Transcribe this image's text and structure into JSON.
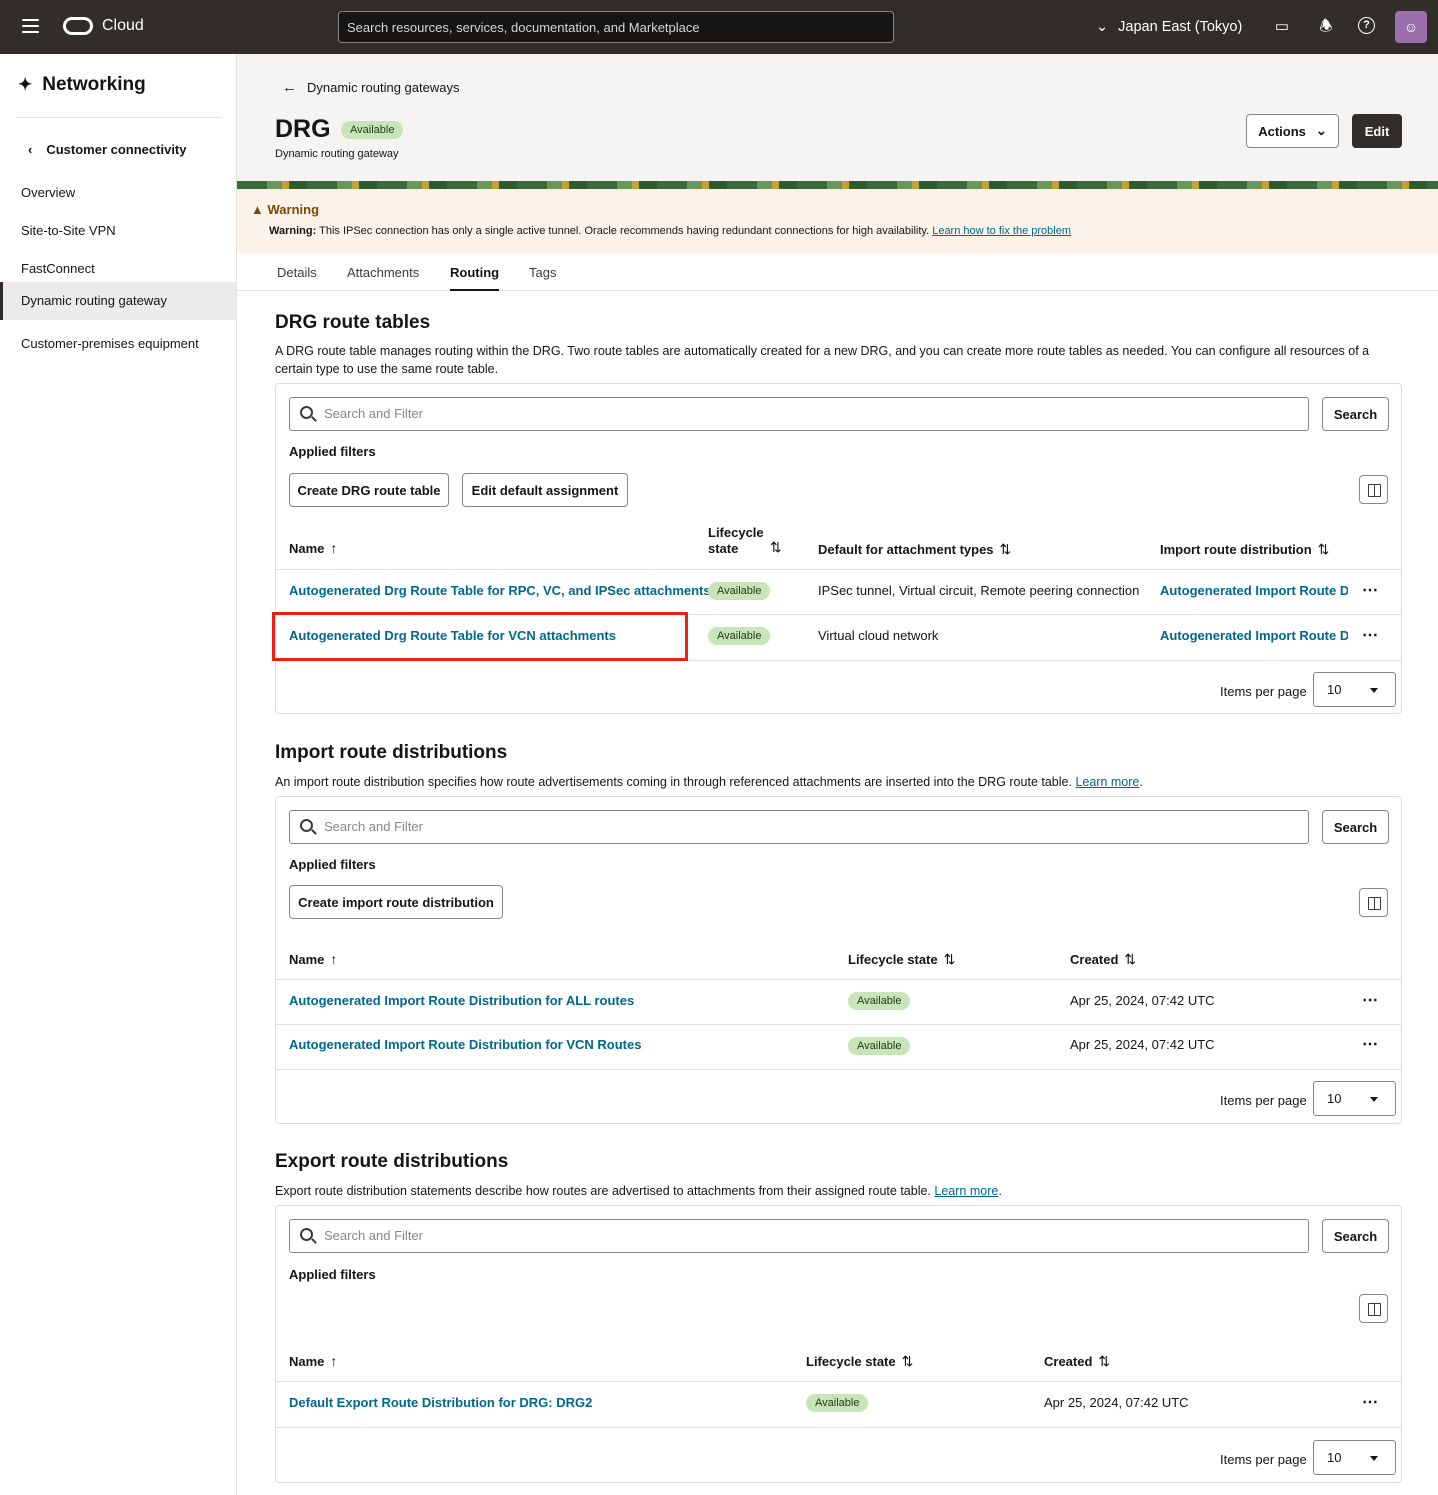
{
  "topbar": {
    "brand": "Cloud",
    "search_placeholder": "Search resources, services, documentation, and Marketplace",
    "region": "Japan East (Tokyo)"
  },
  "sidebar": {
    "title": "Networking",
    "back_label": "Customer connectivity",
    "items": [
      {
        "label": "Overview"
      },
      {
        "label": "Site-to-Site VPN"
      },
      {
        "label": "FastConnect"
      },
      {
        "label": "Dynamic routing gateway",
        "active": true
      },
      {
        "label": "Customer-premises equipment"
      }
    ]
  },
  "header": {
    "back_label": "Dynamic routing gateways",
    "title": "DRG",
    "status": "Available",
    "subtitle": "Dynamic routing gateway",
    "actions_label": "Actions",
    "edit_label": "Edit"
  },
  "warning": {
    "title": "Warning",
    "prefix": "Warning:",
    "message": "This IPSec connection has only a single active tunnel. Oracle recommends having redundant connections for high availability.",
    "link": "Learn how to fix the problem"
  },
  "tabs": [
    "Details",
    "Attachments",
    "Routing",
    "Tags"
  ],
  "common": {
    "search_placeholder": "Search and Filter",
    "search_button": "Search",
    "applied_filters": "Applied filters",
    "items_per_page": "Items per page",
    "page_size": "10"
  },
  "route_tables": {
    "title": "DRG route tables",
    "description": "A DRG route table manages routing within the DRG. Two route tables are automatically created for a new DRG, and you can create more route tables as needed. You can configure all resources of a certain type to use the same route table.",
    "create_button": "Create DRG route table",
    "edit_default_button": "Edit default assignment",
    "columns": {
      "name": "Name",
      "lifecycle": "Lifecycle",
      "lifecycle2": "state",
      "default_types": "Default for attachment types",
      "import_dist": "Import route distribution"
    },
    "rows": [
      {
        "name": "Autogenerated Drg Route Table for RPC, VC, and IPSec attachments",
        "state": "Available",
        "types": "IPSec tunnel, Virtual circuit, Remote peering connection",
        "import": "Autogenerated Import Route Distribution for ALL routes"
      },
      {
        "name": "Autogenerated Drg Route Table for VCN attachments",
        "state": "Available",
        "types": "Virtual cloud network",
        "import": "Autogenerated Import Route Distribution for VCN Routes"
      }
    ]
  },
  "import_dists": {
    "title": "Import route distributions",
    "description": "An import route distribution specifies how route advertisements coming in through referenced attachments are inserted into the DRG route table.",
    "learn_more": "Learn more",
    "create_button": "Create import route distribution",
    "columns": {
      "name": "Name",
      "lifecycle": "Lifecycle state",
      "created": "Created"
    },
    "rows": [
      {
        "name": "Autogenerated Import Route Distribution for ALL routes",
        "state": "Available",
        "created": "Apr 25, 2024, 07:42 UTC"
      },
      {
        "name": "Autogenerated Import Route Distribution for VCN Routes",
        "state": "Available",
        "created": "Apr 25, 2024, 07:42 UTC"
      }
    ]
  },
  "export_dists": {
    "title": "Export route distributions",
    "description": "Export route distribution statements describe how routes are advertised to attachments from their assigned route table.",
    "learn_more": "Learn more",
    "columns": {
      "name": "Name",
      "lifecycle": "Lifecycle state",
      "created": "Created"
    },
    "rows": [
      {
        "name": "Default Export Route Distribution for DRG: DRG2",
        "state": "Available",
        "created": "Apr 25, 2024, 07:42 UTC"
      }
    ]
  },
  "icons": {
    "menu": "hamburger-icon",
    "logo": "oracle-logo",
    "region": "chevron-down-icon",
    "cloudshell": "terminal-icon",
    "notifications": "bell-icon",
    "help": "help-icon",
    "profile": "user-icon"
  }
}
